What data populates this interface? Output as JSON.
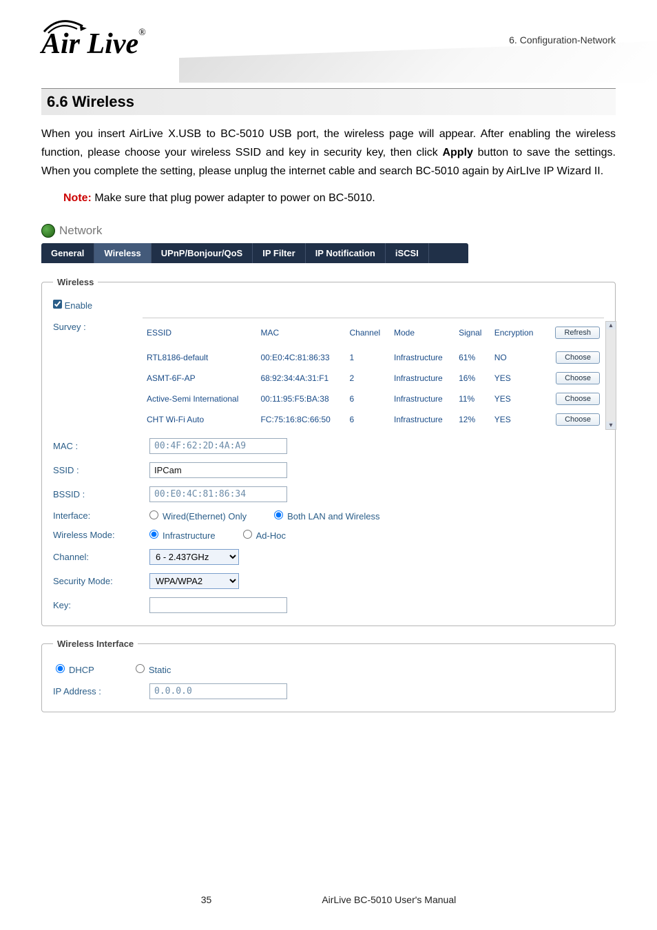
{
  "header": {
    "logo_text": "Air Live",
    "breadcrumb": "6.  Configuration-Network"
  },
  "section": {
    "number_title": "6.6 Wireless",
    "paragraph_pre": "When you insert AirLive X.USB to BC-5010 USB port, the wireless page will appear. After enabling the wireless function, please choose your wireless SSID and key in security key, then click ",
    "paragraph_bold": "Apply",
    "paragraph_post": " button to save the settings. When you complete the setting, please unplug the internet cable and search BC-5010 again by AirLIve IP Wizard II.",
    "note_label": "Note:",
    "note_text": " Make sure that plug power adapter to power on BC-5010."
  },
  "network": {
    "panel_title": "Network",
    "tabs": [
      "General",
      "Wireless",
      "UPnP/Bonjour/QoS",
      "IP Filter",
      "IP Notification",
      "iSCSI"
    ],
    "active_tab_index": 1,
    "wireless_legend": "Wireless",
    "enable_label": "Enable",
    "survey_label": "Survey :",
    "columns": {
      "essid": "ESSID",
      "mac": "MAC",
      "channel": "Channel",
      "mode": "Mode",
      "signal": "Signal",
      "encryption": "Encryption"
    },
    "refresh_btn": "Refresh",
    "choose_btn": "Choose",
    "rows": [
      {
        "essid": "RTL8186-default",
        "mac": "00:E0:4C:81:86:33",
        "channel": "1",
        "mode": "Infrastructure",
        "signal": "61%",
        "enc": "NO"
      },
      {
        "essid": "ASMT-6F-AP",
        "mac": "68:92:34:4A:31:F1",
        "channel": "2",
        "mode": "Infrastructure",
        "signal": "16%",
        "enc": "YES"
      },
      {
        "essid": "Active-Semi International",
        "mac": "00:11:95:F5:BA:38",
        "channel": "6",
        "mode": "Infrastructure",
        "signal": "11%",
        "enc": "YES"
      },
      {
        "essid": "CHT Wi-Fi Auto",
        "mac": "FC:75:16:8C:66:50",
        "channel": "6",
        "mode": "Infrastructure",
        "signal": "12%",
        "enc": "YES"
      }
    ],
    "fields": {
      "mac_label": "MAC :",
      "mac_value": "00:4F:62:2D:4A:A9",
      "ssid_label": "SSID :",
      "ssid_value": "IPCam",
      "bssid_label": "BSSID :",
      "bssid_value": "00:E0:4C:81:86:34",
      "interface_label": "Interface:",
      "interface_opt_wired": "Wired(Ethernet) Only",
      "interface_opt_both": "Both LAN and Wireless",
      "wmode_label": "Wireless Mode:",
      "wmode_infra": "Infrastructure",
      "wmode_adhoc": "Ad-Hoc",
      "channel_label": "Channel:",
      "channel_value": "6 - 2.437GHz",
      "secmode_label": "Security Mode:",
      "secmode_value": "WPA/WPA2",
      "key_label": "Key:",
      "key_value": ""
    },
    "iface_legend": "Wireless Interface",
    "iface_dhcp": "DHCP",
    "iface_static": "Static",
    "iface_ip_label": "IP Address :",
    "iface_ip_value": "0.0.0.0"
  },
  "footer": {
    "page": "35",
    "manual": "AirLive  BC-5010  User's  Manual"
  }
}
